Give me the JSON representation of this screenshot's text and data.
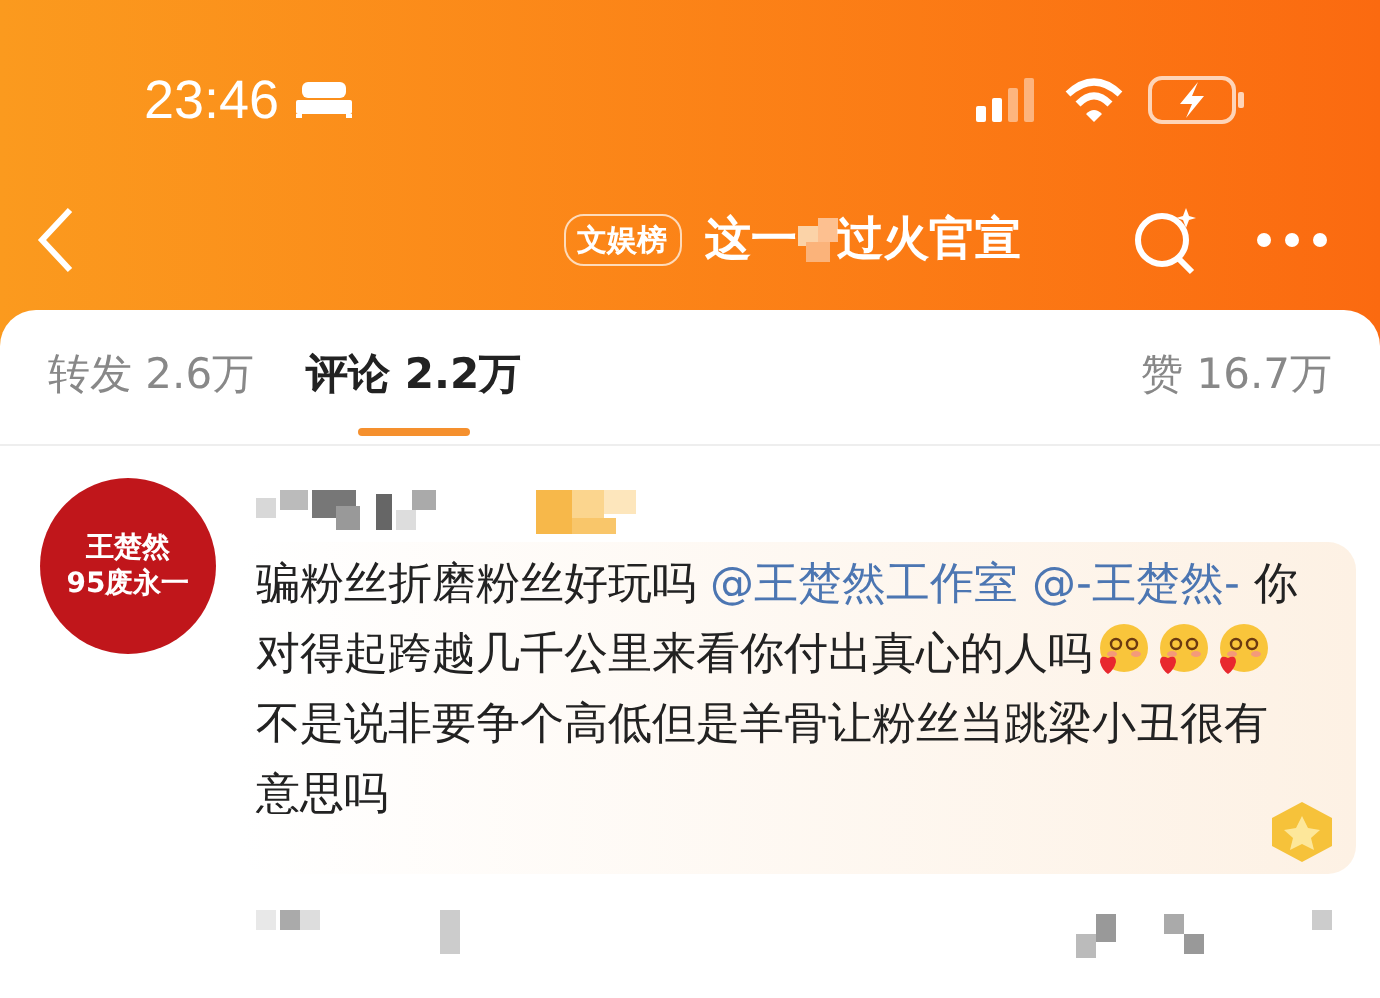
{
  "status_bar": {
    "time": "23:46"
  },
  "nav": {
    "badge": "文娱榜",
    "title_start": "这一",
    "title_end": "过火官宣"
  },
  "tabs": [
    {
      "label": "转发",
      "count": "2.6万",
      "selected": false
    },
    {
      "label": "评论",
      "count": "2.2万",
      "selected": true
    },
    {
      "label": "赞",
      "count": "16.7万",
      "selected": false
    }
  ],
  "comment": {
    "avatar_lines": [
      "王楚然",
      "95废永一"
    ],
    "lines": [
      [
        {
          "kind": "text",
          "text": "骗粉丝折磨粉丝好玩吗 "
        },
        {
          "kind": "mention",
          "text": "@王楚然工作室"
        },
        {
          "kind": "mention",
          "text": "@-王楚然-"
        },
        {
          "kind": "text",
          "text": " 你"
        }
      ],
      [
        {
          "kind": "text",
          "text": "对得起跨越几千公里来看你付出真心的人吗"
        },
        {
          "kind": "emoji"
        },
        {
          "kind": "emoji"
        },
        {
          "kind": "emoji"
        }
      ],
      [
        {
          "kind": "text",
          "text": "不是说非要争个高低但是羊骨让粉丝当跳梁小丑很有"
        }
      ],
      [
        {
          "kind": "text",
          "text": "意思吗"
        }
      ]
    ]
  }
}
